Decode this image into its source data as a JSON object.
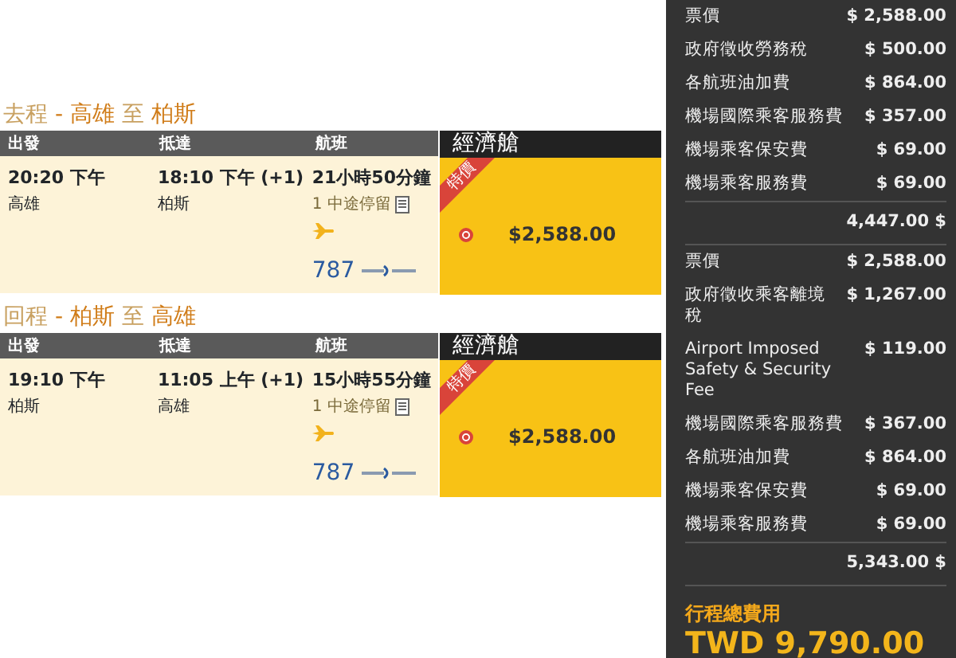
{
  "legs": [
    {
      "direction": "去程",
      "separator": "-",
      "from": "高雄",
      "joiner": "至",
      "to": "柏斯",
      "columns": [
        "出發",
        "抵達",
        "航班"
      ],
      "cabin": "經濟艙",
      "depart_time": "20:20 下午",
      "depart_city": "高雄",
      "arrive_time": "18:10 下午 (+1)",
      "arrive_city": "柏斯",
      "duration": "21小時50分鐘",
      "stops": "1 中途停留",
      "aircraft": "787",
      "promo": "特價",
      "selected": true,
      "price": "$2,588.00"
    },
    {
      "direction": "回程",
      "separator": "-",
      "from": "柏斯",
      "joiner": "至",
      "to": "高雄",
      "columns": [
        "出發",
        "抵達",
        "航班"
      ],
      "cabin": "經濟艙",
      "depart_time": "19:10 下午",
      "depart_city": "柏斯",
      "arrive_time": "11:05 上午 (+1)",
      "arrive_city": "高雄",
      "duration": "15小時55分鐘",
      "stops": "1 中途停留",
      "aircraft": "787",
      "promo": "特價",
      "selected": true,
      "price": "$2,588.00"
    }
  ],
  "summary": {
    "groups": [
      {
        "items": [
          {
            "label": "票價",
            "amount": "$ 2,588.00",
            "kind": "wrap"
          },
          {
            "label": "政府徵收勞務稅",
            "amount": "$ 500.00",
            "kind": "line"
          },
          {
            "label": "各航班油加費",
            "amount": "$ 864.00",
            "kind": "line"
          },
          {
            "label": "機場國際乘客服務費",
            "amount": "$ 357.00",
            "kind": "line"
          },
          {
            "label": "機場乘客保安費",
            "amount": "$ 69.00",
            "kind": "line"
          },
          {
            "label": "機場乘客服務費",
            "amount": "$ 69.00",
            "kind": "line"
          }
        ],
        "subtotal": "4,447.00 $"
      },
      {
        "items": [
          {
            "label": "票價",
            "amount": "$ 2,588.00",
            "kind": "wrap"
          },
          {
            "label": "政府徵收乘客離境稅",
            "amount": "$ 1,267.00",
            "kind": "wrap"
          },
          {
            "label": "Airport Imposed Safety & Security Fee",
            "amount": "$ 119.00",
            "kind": "line"
          },
          {
            "label": "機場國際乘客服務費",
            "amount": "$ 367.00",
            "kind": "line"
          },
          {
            "label": "各航班油加費",
            "amount": "$ 864.00",
            "kind": "line"
          },
          {
            "label": "機場乘客保安費",
            "amount": "$ 69.00",
            "kind": "line"
          },
          {
            "label": "機場乘客服務費",
            "amount": "$ 69.00",
            "kind": "line"
          }
        ],
        "subtotal": "5,343.00 $"
      }
    ],
    "total_label": "行程總費用",
    "total": "TWD 9,790.00"
  }
}
